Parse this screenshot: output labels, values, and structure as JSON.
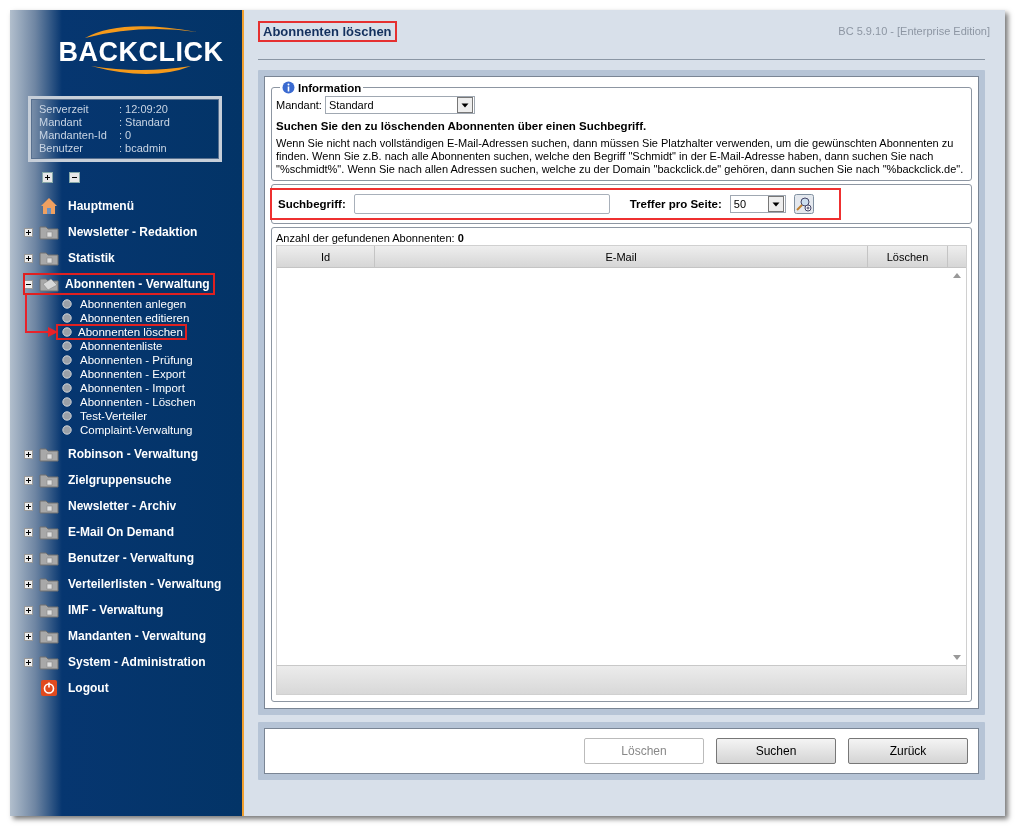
{
  "sidebar": {
    "logo": "BACKCLICK",
    "info": [
      {
        "label": "Serverzeit",
        "value": ": 12:09:20"
      },
      {
        "label": "Mandant",
        "value": ": Standard"
      },
      {
        "label": "Mandanten-Id",
        "value": ": 0"
      },
      {
        "label": "Benutzer",
        "value": ": bcadmin"
      }
    ],
    "nav": [
      {
        "label": "Hauptmenü",
        "kind": "home",
        "highlighted": false
      },
      {
        "label": "Newsletter - Redaktion",
        "kind": "folder",
        "expanded": false,
        "highlighted": false
      },
      {
        "label": "Statistik",
        "kind": "folder",
        "expanded": false,
        "highlighted": false
      },
      {
        "label": "Abonnenten - Verwaltung",
        "kind": "folder",
        "expanded": true,
        "highlighted": true,
        "children": [
          {
            "label": "Abonnenten anlegen",
            "highlighted": false
          },
          {
            "label": "Abonnenten editieren",
            "highlighted": false
          },
          {
            "label": "Abonnenten löschen",
            "highlighted": true
          },
          {
            "label": "Abonnentenliste",
            "highlighted": false
          },
          {
            "label": "Abonnenten - Prüfung",
            "highlighted": false
          },
          {
            "label": "Abonnenten - Export",
            "highlighted": false
          },
          {
            "label": "Abonnenten - Import",
            "highlighted": false
          },
          {
            "label": "Abonnenten - Löschen",
            "highlighted": false
          },
          {
            "label": "Test-Verteiler",
            "highlighted": false
          },
          {
            "label": "Complaint-Verwaltung",
            "highlighted": false
          }
        ]
      },
      {
        "label": "Robinson - Verwaltung",
        "kind": "folder",
        "expanded": false,
        "highlighted": false
      },
      {
        "label": "Zielgruppensuche",
        "kind": "folder",
        "expanded": false,
        "highlighted": false
      },
      {
        "label": "Newsletter - Archiv",
        "kind": "folder",
        "expanded": false,
        "highlighted": false
      },
      {
        "label": "E-Mail On Demand",
        "kind": "folder",
        "expanded": false,
        "highlighted": false
      },
      {
        "label": "Benutzer - Verwaltung",
        "kind": "folder",
        "expanded": false,
        "highlighted": false
      },
      {
        "label": "Verteilerlisten - Verwaltung",
        "kind": "folder",
        "expanded": false,
        "highlighted": false
      },
      {
        "label": "IMF - Verwaltung",
        "kind": "folder",
        "expanded": false,
        "highlighted": false
      },
      {
        "label": "Mandanten - Verwaltung",
        "kind": "folder",
        "expanded": false,
        "highlighted": false
      },
      {
        "label": "System - Administration",
        "kind": "folder",
        "expanded": false,
        "highlighted": false
      },
      {
        "label": "Logout",
        "kind": "logout",
        "highlighted": false
      }
    ]
  },
  "header": {
    "title": "Abonnenten löschen",
    "highlighted": true,
    "version": "BC 5.9.10 - [Enterprise Edition]"
  },
  "info": {
    "legend": "Information",
    "mandant_label": "Mandant:",
    "mandant_value": "Standard",
    "heading": "Suchen Sie den zu löschenden Abonnenten über einen Suchbegriff.",
    "text": "Wenn Sie nicht nach vollständigen E-Mail-Adressen suchen, dann müssen Sie Platzhalter verwenden, um die gewünschten Abonnenten zu finden. Wenn Sie z.B. nach alle Abonnenten suchen, welche den Begriff \"Schmidt\" in der E-Mail-Adresse haben, dann suchen Sie nach \"%schmidt%\". Wenn Sie nach allen Adressen suchen, welche zu der Domain \"backclick.de\" gehören, dann suchen Sie nach \"%backclick.de\"."
  },
  "search": {
    "highlighted": true,
    "label": "Suchbegriff:",
    "per_page_label": "Treffer pro Seite:",
    "per_page_value": "50"
  },
  "results": {
    "count": "Anzahl der gefundenen Abonnenten: **0**",
    "columns": [
      "Id",
      "E-Mail",
      "Löschen"
    ]
  },
  "buttons": [
    {
      "label": "Löschen",
      "disabled": true
    },
    {
      "label": "Suchen",
      "disabled": false
    },
    {
      "label": "Zurück",
      "disabled": false
    }
  ]
}
